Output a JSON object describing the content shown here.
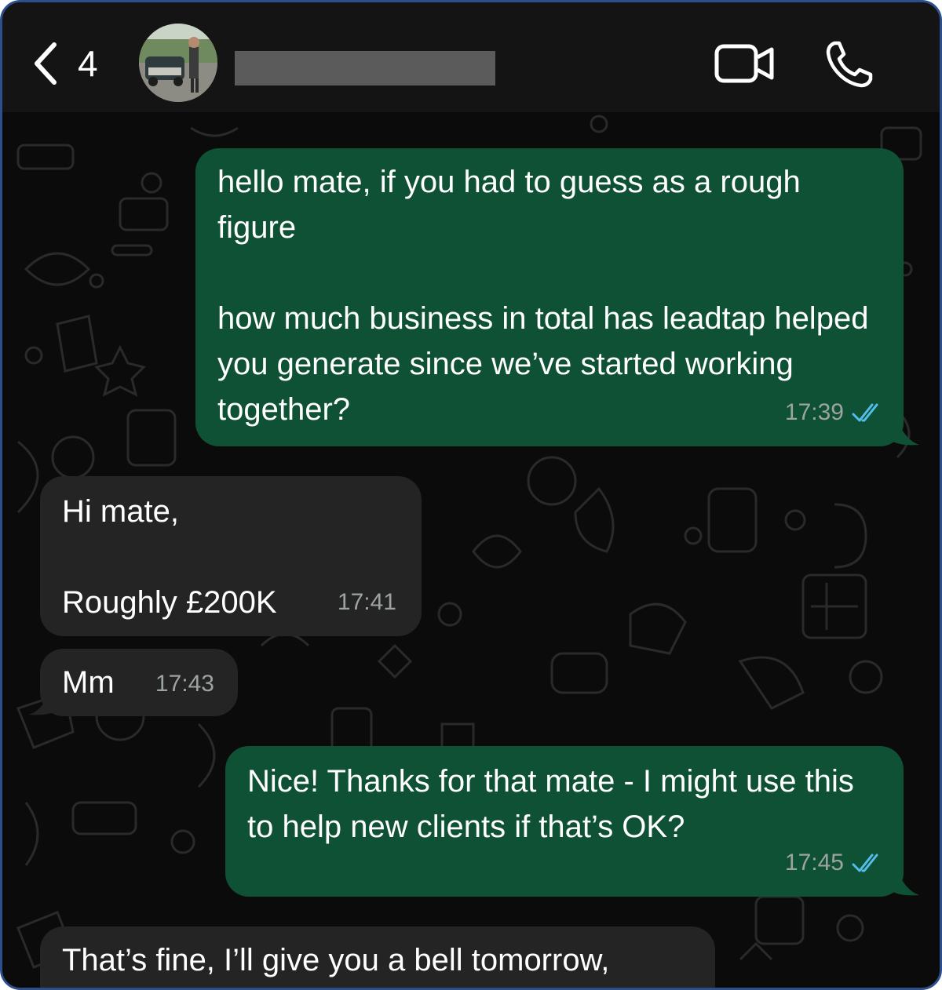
{
  "header": {
    "back_count": "4",
    "contact_name": ""
  },
  "messages": [
    {
      "direction": "outgoing",
      "text": "hello mate, if you had to guess as a rough figure\n\nhow much business in total has leadtap helped you generate since we’ve started working together?",
      "time": "17:39",
      "status": "read"
    },
    {
      "direction": "incoming",
      "text": "Hi mate,\n\nRoughly £200K",
      "time": "17:41"
    },
    {
      "direction": "incoming",
      "text": "Mm",
      "time": "17:43"
    },
    {
      "direction": "outgoing",
      "text": "Nice! Thanks for that mate - I might use this to help new clients if that’s OK?",
      "time": "17:45",
      "status": "read"
    },
    {
      "direction": "incoming",
      "text": "That’s fine, I’ll give you a bell tomorrow,",
      "time": ""
    }
  ],
  "colors": {
    "outgoing_bubble": "#0f5135",
    "incoming_bubble": "#242424",
    "read_tick": "#53bdeb",
    "background": "#0b0b0b"
  },
  "icons": [
    "chevron-left-icon",
    "video-camera-icon",
    "phone-icon",
    "double-check-icon"
  ]
}
